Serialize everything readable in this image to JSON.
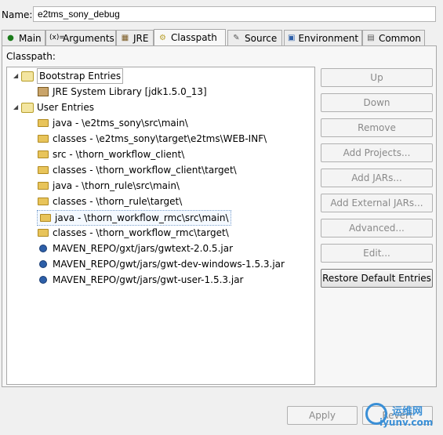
{
  "name": {
    "label": "Name:",
    "value": "e2tms_sony_debug"
  },
  "tabs": [
    {
      "label": "Main",
      "icon": "main-icon"
    },
    {
      "label": "Arguments",
      "icon": "arguments-icon"
    },
    {
      "label": "JRE",
      "icon": "jre-icon"
    },
    {
      "label": "Classpath",
      "icon": "classpath-icon"
    },
    {
      "label": "Source",
      "icon": "source-icon"
    },
    {
      "label": "Environment",
      "icon": "environment-icon"
    },
    {
      "label": "Common",
      "icon": "common-icon"
    }
  ],
  "classpath": {
    "label": "Classpath:",
    "tree": {
      "bootstrap": {
        "label": "Bootstrap Entries",
        "children": [
          "JRE System Library [jdk1.5.0_13]"
        ]
      },
      "user": {
        "label": "User Entries",
        "children": [
          "java - \\e2tms_sony\\src\\main\\",
          "classes - \\e2tms_sony\\target\\e2tms\\WEB-INF\\",
          "src - \\thorn_workflow_client\\",
          "classes - \\thorn_workflow_client\\target\\",
          "java - \\thorn_rule\\src\\main\\",
          "classes - \\thorn_rule\\target\\",
          "java - \\thorn_workflow_rmc\\src\\main\\",
          "classes - \\thorn_workflow_rmc\\target\\",
          "MAVEN_REPO/gxt/jars/gwtext-2.0.5.jar",
          "MAVEN_REPO/gwt/jars/gwt-dev-windows-1.5.3.jar",
          "MAVEN_REPO/gwt/jars/gwt-user-1.5.3.jar"
        ]
      }
    }
  },
  "buttons": {
    "up": "Up",
    "down": "Down",
    "remove": "Remove",
    "add_projects": "Add Projects...",
    "add_jars": "Add JARs...",
    "add_external_jars": "Add External JARs...",
    "advanced": "Advanced...",
    "edit": "Edit...",
    "restore_default": "Restore Default Entries"
  },
  "footer": {
    "apply": "Apply",
    "revert": "Revert"
  },
  "watermark": {
    "line1": "运维网",
    "line2": "iyunv.com"
  }
}
